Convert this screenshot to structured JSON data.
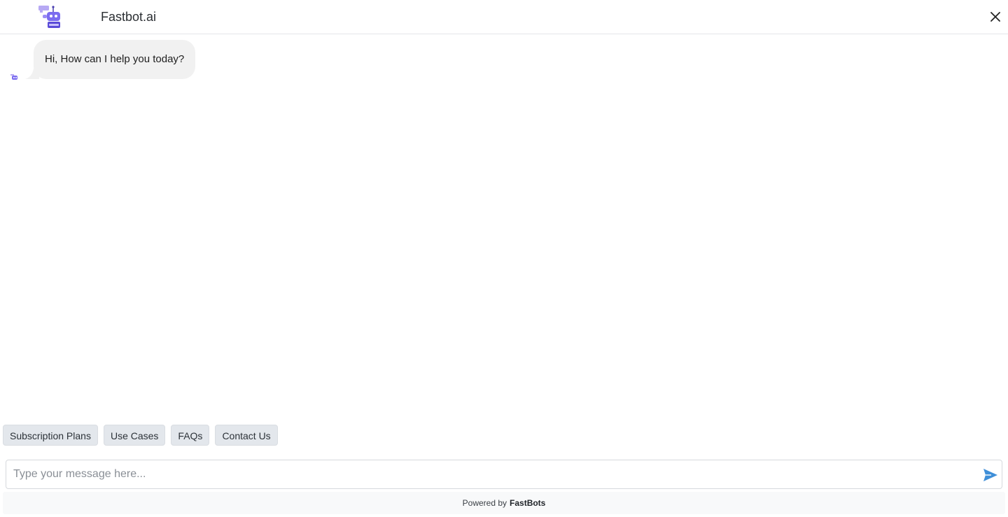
{
  "header": {
    "title": "Fastbot.ai",
    "logo_icon": "robot-logo-icon",
    "close_icon": "close-icon"
  },
  "chat": {
    "messages": [
      {
        "sender": "bot",
        "text": "Hi, How can I help you today?"
      }
    ],
    "bubble_color": "#f1f1f1"
  },
  "quick_replies": [
    "Subscription Plans",
    "Use Cases",
    "FAQs",
    "Contact Us"
  ],
  "composer": {
    "placeholder": "Type your message here...",
    "value": "",
    "send_icon": "send-icon",
    "send_color": "#3f8fd8"
  },
  "footer": {
    "prefix": "Powered by",
    "brand": "FastBots"
  },
  "colors": {
    "accent": "#7b6cf0",
    "chip_bg": "#e3e7ec"
  }
}
